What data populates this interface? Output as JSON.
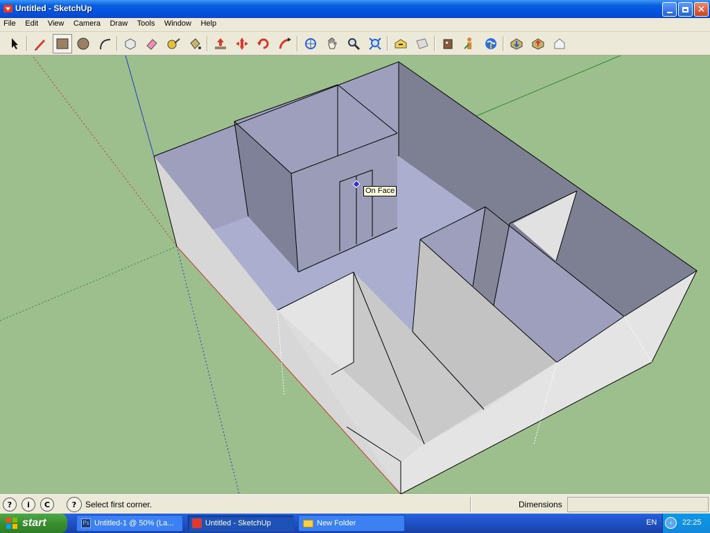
{
  "window": {
    "title": "Untitled - SketchUp"
  },
  "menu": [
    "File",
    "Edit",
    "View",
    "Camera",
    "Draw",
    "Tools",
    "Window",
    "Help"
  ],
  "toolbar": {
    "tools": [
      "select",
      "pencil",
      "rectangle",
      "circle",
      "arc",
      "eraser",
      "paint-bucket",
      "tape-measure",
      "push-pull",
      "move",
      "rotate",
      "follow-me",
      "orbit",
      "pan",
      "zoom",
      "zoom-extents",
      "iso-view",
      "top-view",
      "components",
      "person",
      "google-earth",
      "get-models",
      "share-model",
      "front-view"
    ],
    "active_tool": "rectangle"
  },
  "viewport": {
    "background": "#9dbe8d",
    "tooltip": "On Face"
  },
  "status": {
    "text": "Select first corner.",
    "dimensions_label": "Dimensions",
    "dimensions_value": ""
  },
  "taskbar": {
    "start_label": "start",
    "tasks": [
      {
        "label": "Untitled-1 @ 50% (La...",
        "icon": "photoshop-icon"
      },
      {
        "label": "Untitled - SketchUp",
        "icon": "sketchup-icon"
      },
      {
        "label": "New Folder",
        "icon": "folder-icon"
      }
    ],
    "lang": "EN",
    "clock": "22:25"
  }
}
